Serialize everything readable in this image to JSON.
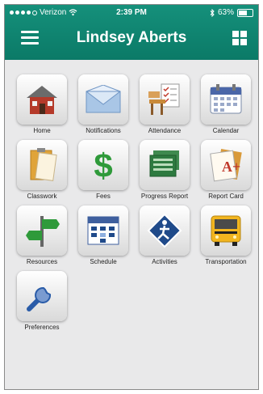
{
  "status_bar": {
    "carrier": "Verizon",
    "time": "2:39 PM",
    "battery": "63%"
  },
  "header": {
    "title": "Lindsey Aberts"
  },
  "tiles": [
    {
      "label": "Home",
      "icon": "house-icon"
    },
    {
      "label": "Notifications",
      "icon": "envelope-icon"
    },
    {
      "label": "Attendance",
      "icon": "desk-checklist-icon"
    },
    {
      "label": "Calendar",
      "icon": "calendar-icon"
    },
    {
      "label": "Classwork",
      "icon": "folder-icon"
    },
    {
      "label": "Fees",
      "icon": "dollar-icon"
    },
    {
      "label": "Progress Report",
      "icon": "report-sheets-icon"
    },
    {
      "label": "Report Card",
      "icon": "report-card-icon"
    },
    {
      "label": "Resources",
      "icon": "signpost-icon"
    },
    {
      "label": "Schedule",
      "icon": "schedule-icon"
    },
    {
      "label": "Activities",
      "icon": "activity-sign-icon"
    },
    {
      "label": "Transportation",
      "icon": "school-bus-icon"
    },
    {
      "label": "Preferences",
      "icon": "wrench-icon"
    }
  ],
  "colors": {
    "header": "#11866f",
    "background": "#e9e9ea"
  }
}
